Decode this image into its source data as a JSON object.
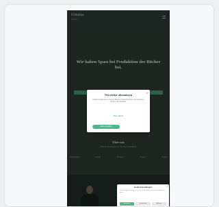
{
  "site": {
    "logo_title": "Fridolina",
    "logo_subtitle": "Bücher",
    "hero_title": "Wir haben Spass bei Produktion der Bücher bei.",
    "section_title": "Über uns",
    "section_subtitle": "Partner und Plattformen, die uns unterstützen",
    "partners": [
      "Buchhandel",
      "Verlag",
      "Bücherei",
      "Presse",
      "Online"
    ]
  },
  "modal": {
    "title": "Newsletter abonnieren",
    "close_glyph": "×",
    "text": "Erhalte Neuigkeiten zu unseren Büchern, Veranstaltungen und Angeboten direkt in dein Postfach.",
    "link": "Mehr erfahren",
    "button_label": "Jetzt anmelden"
  },
  "cookie_banner": {
    "title": "Cookie-Einstellungen",
    "close_glyph": "×",
    "text": "Wir verwenden Cookies, um dir das beste Erlebnis auf unserer Website zu bieten.",
    "accept_label": "Akzeptieren",
    "settings_label": "Einstellungen",
    "decline_label": "Ablehnen"
  },
  "colors": {
    "accent": "#4fb88a",
    "page_bg": "#2b332f"
  }
}
